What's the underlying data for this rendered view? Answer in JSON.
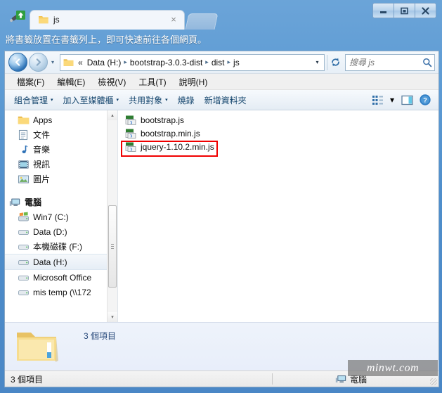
{
  "browser": {
    "wrench_icon": "wrench-update-icon",
    "tab": {
      "title": "js",
      "favicon": "folder-icon",
      "close_label": "×"
    },
    "new_tab_label": "",
    "bookmark_hint": "將書籤放置在書籤列上，即可快速前往各個網頁。",
    "window_buttons": {
      "minimize": "–",
      "maximize": "❐",
      "close": "✕"
    }
  },
  "explorer": {
    "nav": {
      "back_label": "◀",
      "forward_label": "▶",
      "history_label": "▾",
      "refresh_label": "↻",
      "breadcrumb_caret": "▾"
    },
    "breadcrumb": {
      "icon": "folder-icon",
      "prefix": "«",
      "items": [
        "Data (H:)",
        "bootstrap-3.0.3-dist",
        "dist",
        "js"
      ],
      "separator": "▸"
    },
    "search": {
      "placeholder": "搜尋 js",
      "value": "",
      "icon": "search-icon"
    },
    "menubar": [
      "檔案(F)",
      "編輯(E)",
      "檢視(V)",
      "工具(T)",
      "說明(H)"
    ],
    "toolbar": {
      "items": [
        {
          "label": "組合管理",
          "caret": true
        },
        {
          "label": "加入至媒體櫃",
          "caret": true
        },
        {
          "label": "共用對象",
          "caret": true
        },
        {
          "label": "燒錄",
          "caret": false
        },
        {
          "label": "新增資料夾",
          "caret": false
        }
      ],
      "view_icon": "view-options-icon",
      "view_caret": "▾",
      "preview_icon": "preview-pane-icon",
      "help_icon": "help-icon"
    },
    "sidebar": {
      "items": [
        {
          "label": "Apps",
          "icon": "folder-icon",
          "indent": 1,
          "selected": false,
          "group": false
        },
        {
          "label": "文件",
          "icon": "documents-icon",
          "indent": 1,
          "selected": false,
          "group": false
        },
        {
          "label": "音樂",
          "icon": "music-icon",
          "indent": 1,
          "selected": false,
          "group": false
        },
        {
          "label": "視訊",
          "icon": "video-icon",
          "indent": 1,
          "selected": false,
          "group": false
        },
        {
          "label": "圖片",
          "icon": "pictures-icon",
          "indent": 1,
          "selected": false,
          "group": false
        },
        {
          "label": "電腦",
          "icon": "computer-icon",
          "indent": 0,
          "selected": false,
          "group": true
        },
        {
          "label": "Win7 (C:)",
          "icon": "windows-drive-icon",
          "indent": 1,
          "selected": false,
          "group": false
        },
        {
          "label": "Data (D:)",
          "icon": "drive-icon",
          "indent": 1,
          "selected": false,
          "group": false
        },
        {
          "label": "本機磁碟 (F:)",
          "icon": "drive-icon",
          "indent": 1,
          "selected": false,
          "group": false
        },
        {
          "label": "Data (H:)",
          "icon": "drive-icon",
          "indent": 1,
          "selected": true,
          "group": false
        },
        {
          "label": "Microsoft Office",
          "icon": "drive-icon",
          "indent": 1,
          "selected": false,
          "group": false
        },
        {
          "label": "mis temp (\\\\172",
          "icon": "drive-icon",
          "indent": 1,
          "selected": false,
          "group": false
        }
      ],
      "scrollbar": {
        "up_arrow": "▴",
        "down_arrow": "▾"
      }
    },
    "files": [
      {
        "name": "bootstrap.js",
        "icon": "js-file-icon",
        "highlighted": false
      },
      {
        "name": "bootstrap.min.js",
        "icon": "js-file-icon",
        "highlighted": false
      },
      {
        "name": "jquery-1.10.2.min.js",
        "icon": "js-file-icon",
        "highlighted": true
      }
    ],
    "annotation_color": "#f00000",
    "details_pane": {
      "icon": "large-folder-icon",
      "text": "3 個項目"
    },
    "statusbar": {
      "left": "3 個項目",
      "right_icon": "computer-icon",
      "right": "電腦"
    }
  },
  "watermark": "minwt.com"
}
